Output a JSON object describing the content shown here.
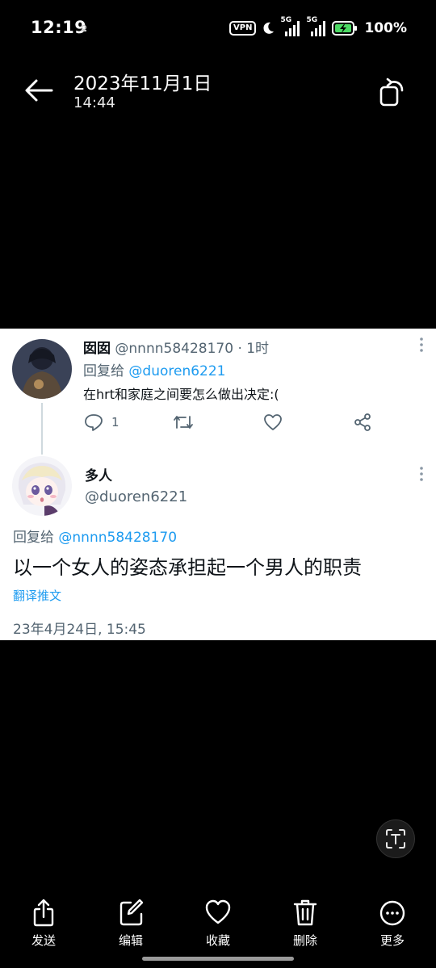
{
  "status_bar": {
    "time": "12:19",
    "vpn_label": "VPN",
    "network_1": "5G",
    "network_2": "5G",
    "battery_percent": "100%"
  },
  "header": {
    "date": "2023年11月1日",
    "time": "14:44"
  },
  "tweet_screenshot": {
    "reply_tweet": {
      "display_name": "囡囡",
      "handle": "@nnnn58428170",
      "age": "· 1时",
      "reply_to_prefix": "回复给 ",
      "reply_to_handle": "@duoren6221",
      "text": "在hrt和家庭之间要怎么做出决定:(",
      "reply_count": "1"
    },
    "main_tweet": {
      "display_name": "多人",
      "handle": "@duoren6221",
      "reply_to_prefix": "回复给 ",
      "reply_to_handle": "@nnnn58428170",
      "text": "以一个女人的姿态承担起一个男人的职责",
      "translate_label": "翻译推文",
      "timestamp": "23年4月24日, 15:45"
    }
  },
  "toolbar": {
    "send_label": "发送",
    "edit_label": "编辑",
    "favorite_label": "收藏",
    "delete_label": "删除",
    "more_label": "更多"
  },
  "icons": {
    "back": "arrow-left-icon",
    "rotate": "rotate-icon",
    "scan": "text-scan-icon"
  },
  "colors": {
    "background": "#000000",
    "card": "#ffffff",
    "link": "#1d9bf0",
    "muted": "#536471"
  }
}
